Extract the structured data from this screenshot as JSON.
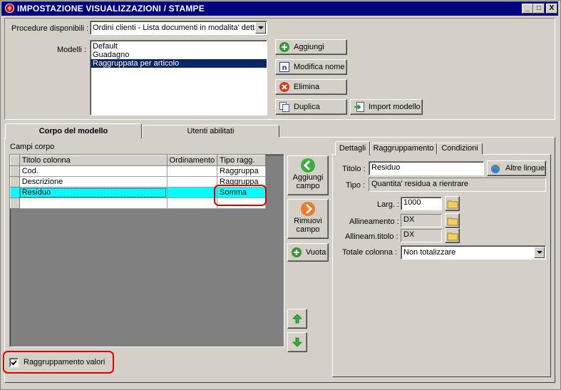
{
  "window": {
    "title": "IMPOSTAZIONE VISUALIZZAZIONI / STAMPE",
    "controls": {
      "minimize": "_",
      "maximize": "□",
      "close": "X"
    }
  },
  "top": {
    "procedures_label": "Procedure disponibili :",
    "procedures_value": "Ordini clienti - Lista documenti in modalita' dettag",
    "models_label": "Modelli :",
    "models": [
      "Default",
      "Guadagno",
      "Raggruppata per articolo"
    ],
    "models_selected_index": 2,
    "buttons": {
      "add": "Aggiungi",
      "rename": "Modifica nome",
      "delete": "Elimina",
      "duplicate": "Duplica",
      "import": "Import modello"
    }
  },
  "tabs": {
    "body": "Corpo del modello",
    "users": "Utenti abilitati"
  },
  "fields": {
    "section_label": "Campi corpo",
    "columns": [
      "Titolo colonna",
      "Ordinamento",
      "Tipo ragg."
    ],
    "rows": [
      {
        "title": "Cod.",
        "order": "",
        "type": "Raggruppa"
      },
      {
        "title": "Descrizione",
        "order": "",
        "type": "Raggruppa"
      },
      {
        "title": "Residuo",
        "order": "",
        "type": "Somma"
      },
      {
        "title": "",
        "order": "",
        "type": ""
      }
    ],
    "selected_row": 2,
    "add_field": "Aggiungi campo",
    "remove_field": "Rimuovi campo",
    "clear": "Vuota",
    "grouping_values_label": "Raggruppamento valori",
    "grouping_values_checked": true
  },
  "details": {
    "tabs": [
      "Dettagli",
      "Raggruppamento",
      "Condizioni"
    ],
    "title_label": "Titolo :",
    "title_value": "Residuo",
    "other_languages": "Altre lingue",
    "type_label": "Tipo :",
    "type_value": "Quantita' residua a rientrare",
    "width_label": "Larg. :",
    "width_value": "1000",
    "align_label": "Allineamento :",
    "align_value": "DX",
    "title_align_label": "Allineam.titolo :",
    "title_align_value": "DX",
    "total_label": "Totale colonna :",
    "total_value": "Non totalizzare"
  },
  "colors": {
    "titlebar": "#000080",
    "selection": "#0a246a",
    "grid_selection": "#00ffff",
    "highlight_mark": "#e00000"
  }
}
